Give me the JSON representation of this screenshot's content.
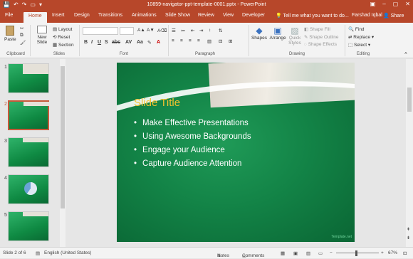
{
  "window": {
    "title": "10859-navigator-ppt-template-0001.pptx - PowerPoint",
    "brand_color": "#b7472a"
  },
  "tabs": [
    {
      "label": "File"
    },
    {
      "label": "Home"
    },
    {
      "label": "Insert"
    },
    {
      "label": "Design"
    },
    {
      "label": "Transitions"
    },
    {
      "label": "Animations"
    },
    {
      "label": "Slide Show"
    },
    {
      "label": "Review"
    },
    {
      "label": "View"
    },
    {
      "label": "Developer"
    }
  ],
  "tell_me": "Tell me what you want to do...",
  "user": "Farshad Iqbal",
  "share_label": "Share",
  "ribbon": {
    "clipboard": {
      "paste": "Paste",
      "label": "Clipboard"
    },
    "slides": {
      "new_slide": "New Slide",
      "layout": "Layout",
      "reset": "Reset",
      "section": "Section",
      "label": "Slides"
    },
    "font": {
      "label": "Font"
    },
    "paragraph": {
      "label": "Paragraph"
    },
    "drawing": {
      "shapes": "Shapes",
      "arrange": "Arrange",
      "quick_styles": "Quick Styles",
      "shape_fill": "Shape Fill",
      "shape_outline": "Shape Outline",
      "shape_effects": "Shape Effects",
      "label": "Drawing"
    },
    "editing": {
      "find": "Find",
      "replace": "Replace",
      "select": "Select",
      "label": "Editing"
    }
  },
  "thumbnails": [
    {
      "num": "1",
      "selected": false
    },
    {
      "num": "2",
      "selected": true
    },
    {
      "num": "3",
      "selected": false
    },
    {
      "num": "4",
      "selected": false
    },
    {
      "num": "5",
      "selected": false
    }
  ],
  "slide": {
    "title": "Slide Title",
    "bullets": [
      "Make Effective Presentations",
      "Using Awesome Backgrounds",
      "Engage your Audience",
      "Capture Audience Attention"
    ],
    "watermark": "Template.net",
    "title_color": "#f2c230"
  },
  "status": {
    "slide_of": "Slide 2 of 6",
    "language": "English (United States)",
    "notes": "Notes",
    "comments": "Comments",
    "zoom": "67%"
  }
}
